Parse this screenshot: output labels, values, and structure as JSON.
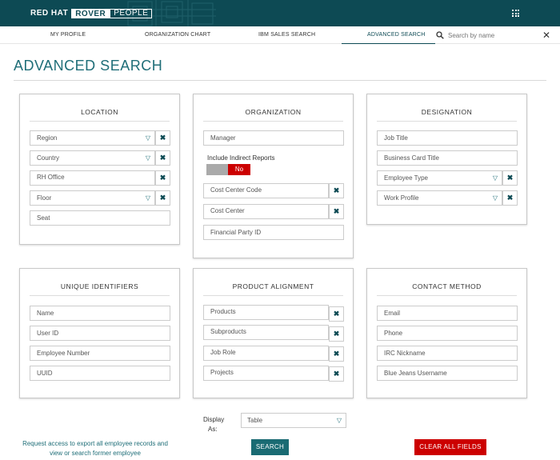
{
  "header": {
    "brand_rh": "RED HAT",
    "brand_rover": "ROVER",
    "brand_people": "PEOPLE",
    "apps_icon": "grid-icon"
  },
  "nav": {
    "items": [
      {
        "label": "MY PROFILE"
      },
      {
        "label": "ORGANIZATION CHART"
      },
      {
        "label": "IBM SALES SEARCH"
      },
      {
        "label": "ADVANCED SEARCH"
      }
    ],
    "active": "ADVANCED SEARCH",
    "search_placeholder": "Search by name"
  },
  "page": {
    "title": "ADVANCED SEARCH"
  },
  "panels": {
    "location": {
      "title": "LOCATION",
      "fields": [
        "Region",
        "Country",
        "RH Office",
        "Floor",
        "Seat"
      ]
    },
    "organization": {
      "title": "ORGANIZATION",
      "manager": "Manager",
      "indirect_label": "Include Indirect Reports",
      "indirect_value": "No",
      "cost_center_code": "Cost Center Code",
      "cost_center": "Cost Center",
      "financial_party": "Financial Party ID"
    },
    "designation": {
      "title": "DESIGNATION",
      "fields": [
        "Job Title",
        "Business Card Title",
        "Employee Type",
        "Work Profile"
      ]
    },
    "unique": {
      "title": "UNIQUE IDENTIFIERS",
      "fields": [
        "Name",
        "User ID",
        "Employee Number",
        "UUID"
      ]
    },
    "product": {
      "title": "PRODUCT ALIGNMENT",
      "fields": [
        "Products",
        "Subproducts",
        "Job Role",
        "Projects"
      ]
    },
    "contact": {
      "title": "CONTACT METHOD",
      "fields": [
        "Email",
        "Phone",
        "IRC Nickname",
        "Blue Jeans Username"
      ]
    }
  },
  "footer": {
    "display_label_1": "Display",
    "display_label_2": "As:",
    "display_value": "Table",
    "search_button": "SEARCH",
    "clear_button": "CLEAR ALL FIELDS",
    "request_line_1": "Request access to export all employee records and",
    "request_line_2": "view or search former employee"
  },
  "colors": {
    "header_bg": "#0d4a54",
    "accent_teal": "#1f6e78",
    "danger_red": "#cc0000"
  }
}
